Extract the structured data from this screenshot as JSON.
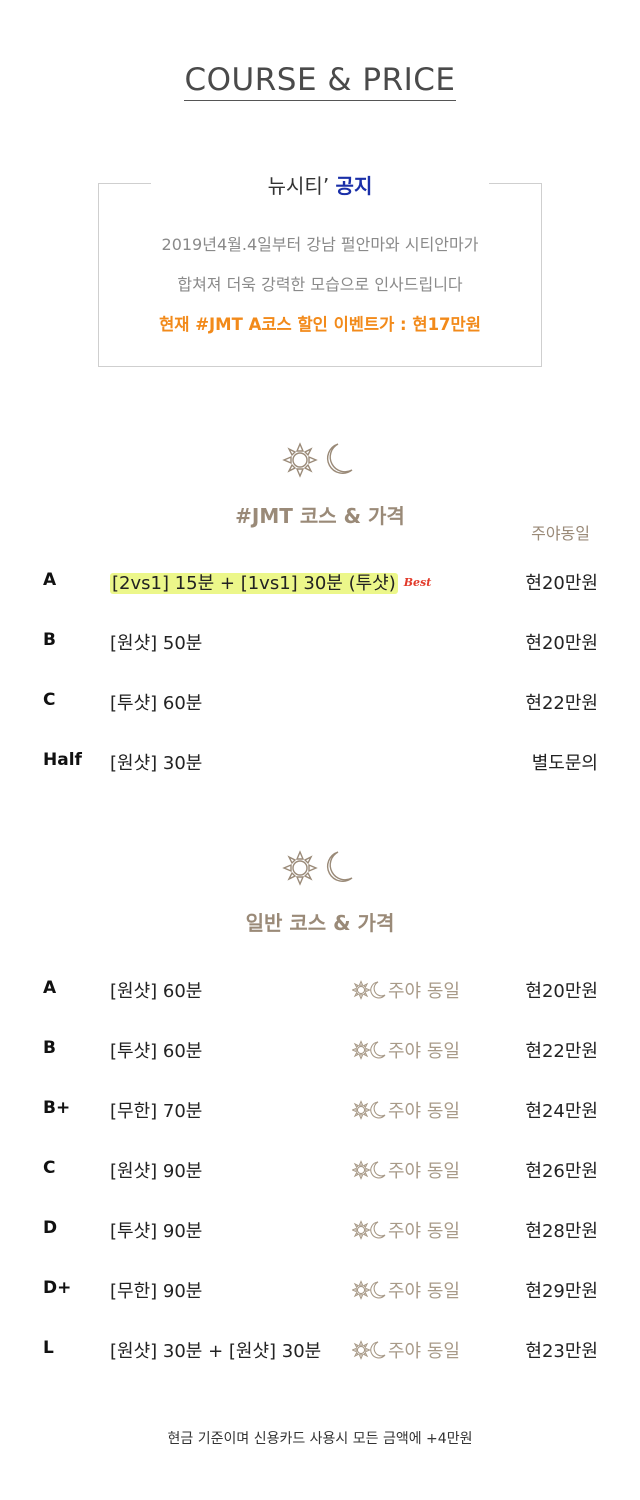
{
  "header": {
    "title": "COURSE & PRICE"
  },
  "notice": {
    "brand": "뉴시티’",
    "label": "공지",
    "line1": "2019년4월.4일부터 강남 펄안마와 시티안마가",
    "line2": "합쳐져 더욱 강력한 모습으로 인사드립니다",
    "line3": "현재 #JMT A코스 할인 이벤트가 : 현17만원"
  },
  "jmt": {
    "icon": "sun-moon-icon",
    "title": "#JMT 코스 & 가격",
    "column_label": "주야동일",
    "rows": [
      {
        "code": "A",
        "desc": "[2vs1] 15분 + [1vs1] 30분 (투샷)",
        "badge": "Best",
        "price": "현20만원"
      },
      {
        "code": "B",
        "desc": "[원샷] 50분",
        "price": "현20만원"
      },
      {
        "code": "C",
        "desc": "[투샷] 60분",
        "price": "현22만원"
      },
      {
        "code": "Half",
        "desc": "[원샷] 30분",
        "price": "별도문의"
      }
    ]
  },
  "general": {
    "icon": "sun-moon-icon",
    "title": "일반 코스 & 가격",
    "rows": [
      {
        "code": "A",
        "desc": "[원샷] 60분",
        "hours": "주야 동일",
        "price": "현20만원"
      },
      {
        "code": "B",
        "desc": "[투샷] 60분",
        "hours": "주야 동일",
        "price": "현22만원"
      },
      {
        "code": "B+",
        "desc": "[무한] 70분",
        "hours": "주야 동일",
        "price": "현24만원"
      },
      {
        "code": "C",
        "desc": "[원샷] 90분",
        "hours": "주야 동일",
        "price": "현26만원"
      },
      {
        "code": "D",
        "desc": "[투샷] 90분",
        "hours": "주야 동일",
        "price": "현28만원"
      },
      {
        "code": "D+",
        "desc": "[무한] 90분",
        "hours": "주야 동일",
        "price": "현29만원"
      },
      {
        "code": "L",
        "desc": "[원샷] 30분 + [원샷] 30분",
        "hours": "주야 동일",
        "price": "현23만원"
      }
    ]
  },
  "footer": {
    "note": "현금 기준이며 신용카드 사용시 모든 금액에 +4만원"
  },
  "colors": {
    "accent_tan": "#9a8a78",
    "notice_blue": "#1a2fa8",
    "event_orange": "#f28a1a",
    "highlight": "#ecf78a",
    "best_red": "#e23a2a"
  }
}
